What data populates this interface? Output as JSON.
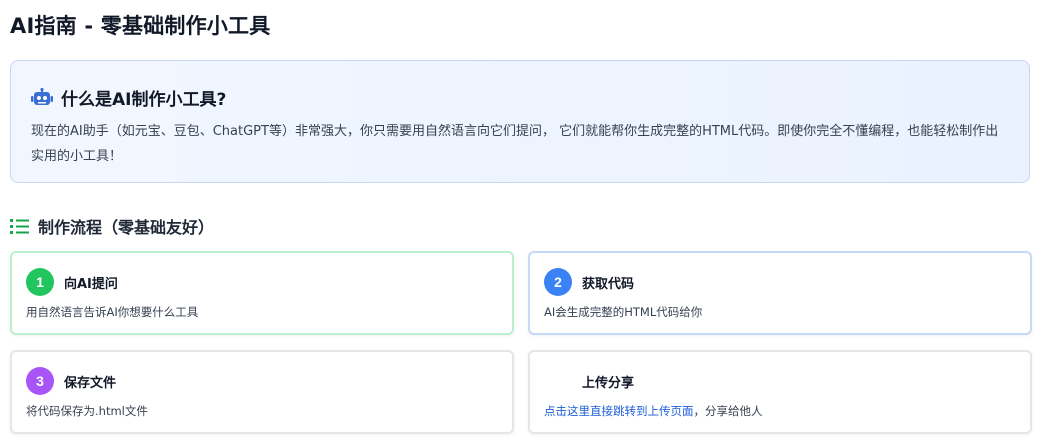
{
  "page_title": "AI指南 - 零基础制作小工具",
  "intro": {
    "icon": "robot-icon",
    "title": "什么是AI制作小工具?",
    "text": "现在的AI助手（如元宝、豆包、ChatGPT等）非常强大，你只需要用自然语言向它们提问， 它们就能帮你生成完整的HTML代码。即使你完全不懂编程，也能轻松制作出实用的小工具！"
  },
  "process": {
    "icon": "list-icon",
    "title": "制作流程（零基础友好）",
    "steps": [
      {
        "number": "1",
        "title": "向AI提问",
        "desc": "用自然语言告诉AI你想要什么工具",
        "color": "#22c55e"
      },
      {
        "number": "2",
        "title": "获取代码",
        "desc": "AI会生成完整的HTML代码给你",
        "color": "#3b82f6"
      },
      {
        "number": "3",
        "title": "保存文件",
        "desc": "将代码保存为.html文件",
        "color": "#a855f7"
      },
      {
        "number": "",
        "title": "上传分享",
        "desc_link": "点击这里直接跳转到上传页面",
        "desc_rest": "，分享给他人"
      }
    ]
  },
  "colors": {
    "intro_border": "#c7d7f2",
    "intro_bg": "#eef4ff",
    "link": "#1d5fd6"
  }
}
